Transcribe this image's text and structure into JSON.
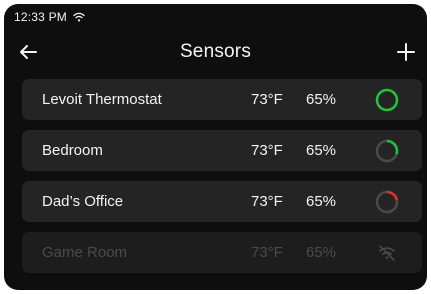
{
  "status_bar": {
    "time": "12:33 PM",
    "wifi_icon": "wifi-icon"
  },
  "header": {
    "title": "Sensors",
    "back_icon": "arrow-left-icon",
    "add_icon": "plus-icon"
  },
  "sensors": [
    {
      "name": "Levoit Thermostat",
      "temperature": "73°F",
      "humidity": "65%",
      "status": "online",
      "ring_color": "#1fc33a",
      "ring_level": 1.0
    },
    {
      "name": "Bedroom",
      "temperature": "73°F",
      "humidity": "65%",
      "status": "online",
      "ring_color": "#1fc33a",
      "ring_level": 0.3
    },
    {
      "name": "Dad’s Office",
      "temperature": "73°F",
      "humidity": "65%",
      "status": "online",
      "ring_color": "#e0322e",
      "ring_level": 0.22
    },
    {
      "name": "Game Room",
      "temperature": "73°F",
      "humidity": "65%",
      "status": "offline",
      "status_icon": "wifi-off-icon"
    }
  ],
  "colors": {
    "background": "#0e0e0e",
    "row": "#242424",
    "row_offline": "#1d1d1d",
    "ring_track": "#4a4a4a",
    "text": "#f3f3f3",
    "text_offline": "#4a4a4a"
  }
}
